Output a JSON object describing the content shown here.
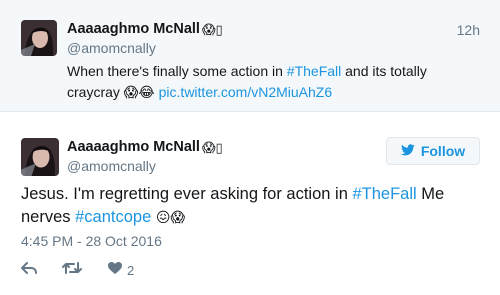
{
  "parent_tweet": {
    "display_name": "Aaaaaghmo McNall",
    "name_emoji": "😱▯",
    "handle": "@amomcnally",
    "time_ago": "12h",
    "text_part1": "When there's finally some action in ",
    "hashtag": "#TheFall",
    "text_part2": " and its totally craycray ",
    "emojis": "😱😂",
    "pic_link": "pic.twitter.com/vN2MiuAhZ6"
  },
  "main_tweet": {
    "display_name": "Aaaaaghmo McNall",
    "name_emoji": "😱▯",
    "handle": "@amomcnally",
    "follow_label": "Follow",
    "text_part1": "Jesus. I'm regretting ever asking for action in ",
    "hashtag1": "#TheFall",
    "text_part2": " Me nerves ",
    "hashtag2": "#cantcope",
    "emojis": "😖😱",
    "timestamp": "4:45 PM - 28 Oct 2016",
    "like_count": "2"
  },
  "icons": {
    "reply": "reply-icon",
    "retweet": "retweet-icon",
    "like": "heart-icon",
    "follow": "twitter-bird-icon"
  },
  "colors": {
    "link": "#1b95e0",
    "secondary": "#657786",
    "parent_background": "#f5f8fa",
    "border": "#e1e8ed"
  }
}
